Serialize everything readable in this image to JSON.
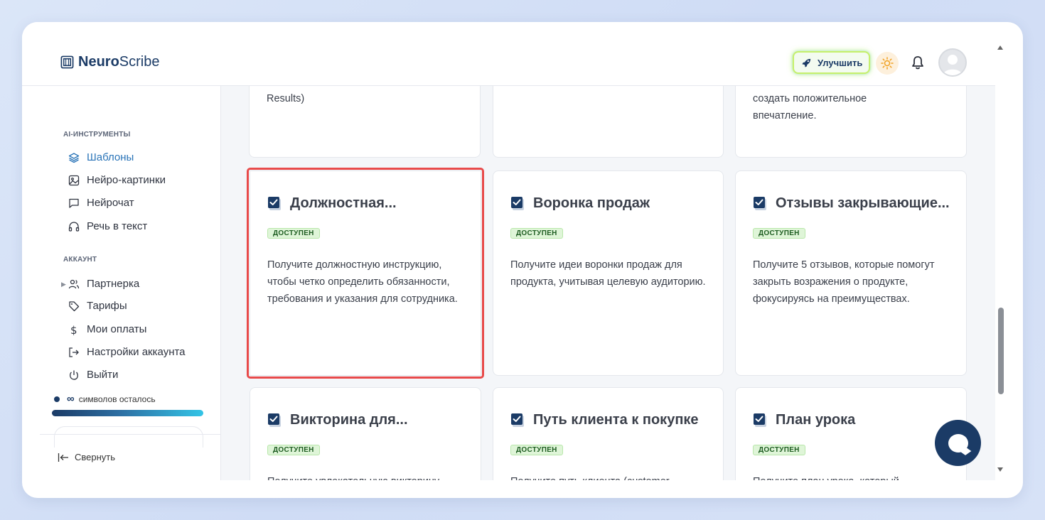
{
  "app": {
    "logo_bold": "Neuro",
    "logo_light": "Scribe",
    "upgrade_label": "Улучшить"
  },
  "sidebar": {
    "section_tools": "AI-ИНСТРУМЕНТЫ",
    "tools": [
      {
        "label": "Шаблоны",
        "icon": "layers-icon"
      },
      {
        "label": "Нейро-картинки",
        "icon": "image-icon"
      },
      {
        "label": "Нейрочат",
        "icon": "chat-icon"
      },
      {
        "label": "Речь в текст",
        "icon": "headphones-icon"
      }
    ],
    "section_account": "АККАУНТ",
    "account": [
      {
        "label": "Партнерка",
        "icon": "users-icon"
      },
      {
        "label": "Тарифы",
        "icon": "tag-icon"
      },
      {
        "label": "Мои оплаты",
        "icon": "dollar-icon"
      },
      {
        "label": "Настройки аккаунта",
        "icon": "logout-icon"
      },
      {
        "label": "Выйти",
        "icon": "power-icon"
      }
    ],
    "credits_symbol": "∞",
    "credits_text": "символов осталось",
    "collapse_label": "Свернуть"
  },
  "cards_top": [
    {
      "desc": "Results)"
    },
    {
      "desc": ""
    },
    {
      "desc": "создать положительное впечатление."
    }
  ],
  "cards": [
    {
      "title": "Должностная...",
      "badge": "ДОСТУПЕН",
      "desc": "Получите должностную инструкцию, чтобы четко определить обязанности, требования и указания для сотрудника."
    },
    {
      "title": "Воронка продаж",
      "badge": "ДОСТУПЕН",
      "desc": "Получите идеи воронки продаж для продукта, учитывая целевую аудиторию."
    },
    {
      "title": "Отзывы закрывающие...",
      "badge": "ДОСТУПЕН",
      "desc": "Получите 5 отзывов, которые помогут закрыть возражения о продукте, фокусируясь на преимуществах."
    },
    {
      "title": "Викторина для...",
      "badge": "ДОСТУПЕН",
      "desc": "Получите увлекательную викторину"
    },
    {
      "title": "Путь клиента к покупке",
      "badge": "ДОСТУПЕН",
      "desc": "Получите путь клиента (customer"
    },
    {
      "title": "План урока",
      "badge": "ДОСТУПЕН",
      "desc": "Получите план урока, который"
    }
  ],
  "colors": {
    "brand": "#1b3b66",
    "active": "#2a74b8",
    "highlight": "#e84a4a",
    "badge_bg": "#dff5d8"
  }
}
